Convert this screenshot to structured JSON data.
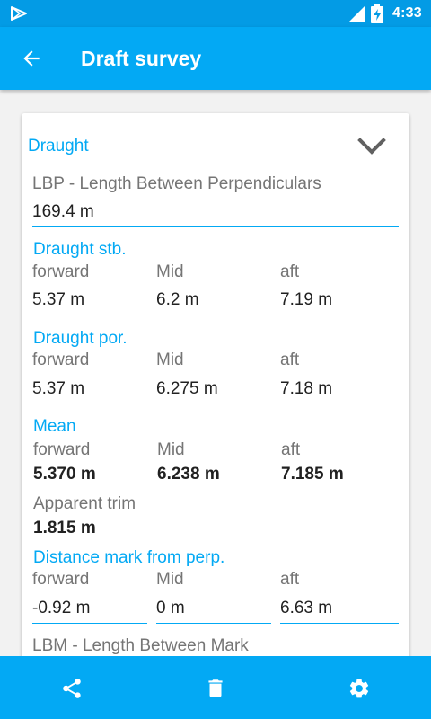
{
  "status_bar": {
    "time": "4:33"
  },
  "app_bar": {
    "title": "Draft survey"
  },
  "section": {
    "title": "Draught"
  },
  "lbp": {
    "label": "LBP - Length Between Perpendiculars",
    "value": "169.4 m"
  },
  "col_labels": {
    "forward": "forward",
    "mid": "Mid",
    "aft": "aft"
  },
  "draught_stb": {
    "title": "Draught stb.",
    "forward": "5.37 m",
    "mid": "6.2 m",
    "aft": "7.19 m"
  },
  "draught_por": {
    "title": "Draught por.",
    "forward": "5.37 m",
    "mid": "6.275 m",
    "aft": "7.18 m"
  },
  "mean": {
    "title": "Mean",
    "forward": "5.370 m",
    "mid": "6.238 m",
    "aft": "7.185 m"
  },
  "trim": {
    "label": "Apparent trim",
    "value": "1.815 m"
  },
  "distance": {
    "title": "Distance mark from perp.",
    "forward": "-0.92 m",
    "mid": "0 m",
    "aft": "6.63 m"
  },
  "lbm": {
    "label": "LBM - Length Between Mark"
  },
  "icons": {
    "back": "arrow-back-icon",
    "collapse": "chevron-down-icon",
    "share": "share-icon",
    "delete": "trash-icon",
    "settings": "gear-icon"
  },
  "colors": {
    "primary": "#03a9f4",
    "status_bar": "#039be5",
    "text": "#212121",
    "label": "#757575"
  }
}
